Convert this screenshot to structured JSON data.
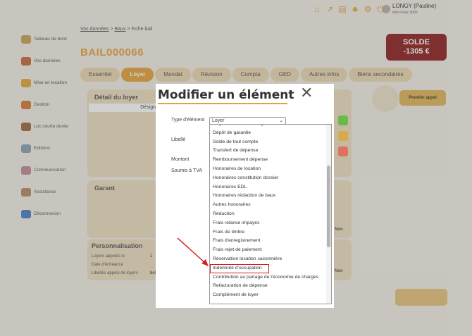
{
  "user": {
    "name": "LONGY (Pauline)",
    "subtitle": "Intro Futur 3000"
  },
  "sidebar": {
    "items": [
      {
        "label": "Tableau de bord",
        "color": "#c9a25b"
      },
      {
        "label": "Vos données",
        "color": "#c66a3b"
      },
      {
        "label": "Mise en location",
        "color": "#e0a83a"
      },
      {
        "label": "Gestion",
        "color": "#d87a3a"
      },
      {
        "label": "Loc courte durée",
        "color": "#9a6b42"
      },
      {
        "label": "Editions",
        "color": "#8aa0b0"
      },
      {
        "label": "Communication",
        "color": "#c08a9a"
      },
      {
        "label": "Assistance",
        "color": "#b58a6a"
      },
      {
        "label": "Déconnexion",
        "color": "#4a80c0"
      }
    ]
  },
  "breadcrumb": {
    "part1": "Vos données",
    "sep": ">",
    "part2": "Baux",
    "part3": "> Fiche bail"
  },
  "page_title": "BAIL000066",
  "solde": {
    "label": "SOLDE",
    "value": "-1305 €"
  },
  "tabs": [
    "Essentiel",
    "Loyer",
    "Mandat",
    "Révision",
    "Compta",
    "GED",
    "Autres infos",
    "Biens secondaires"
  ],
  "panels": {
    "detail": "Détail du loyer",
    "detail_col": "Désign",
    "garant": "Garant",
    "perso": "Personnalisation",
    "perso_rows": [
      "Loyers appelés le",
      "Date d'échéance",
      "Libellés appels de loyers"
    ],
    "perso_val1": "1",
    "perso_val3": "belle journée",
    "non1": "Non",
    "non2": "Non"
  },
  "premier_appel": "Premier appel",
  "modal": {
    "title": "Modifier un élément",
    "labels": {
      "type": "Type d'élément",
      "libelle": "Libellé",
      "montant": "Montant",
      "tva": "Soumis à TVA"
    },
    "select_value": "Loyer",
    "options": [
      "Régularisation de charges",
      "Dépôt de garantie",
      "Solde de tout compte",
      "Transfert de dépense",
      "Remboursement dépense",
      "Honoraires de location",
      "Honoraires constitution dossier",
      "Honoraires EDL",
      "Honoraires rédaction de baux",
      "Autres honoraires",
      "Réduction",
      "Frais relance impayés",
      "Frais de timbre",
      "Frais d'enregistrement",
      "Frais rejet de paiement",
      "Réservation location saisonnière",
      "Indemnité d'occupation",
      "Contribution au partage de l'économie de charges",
      "Refacturation de dépense",
      "Complément de loyer"
    ],
    "highlighted_option": "Indemnité d'occupation"
  },
  "colors": {
    "accent": "#e5a23a",
    "solde_bg": "#8e1f1f",
    "highlight": "#d42020"
  }
}
